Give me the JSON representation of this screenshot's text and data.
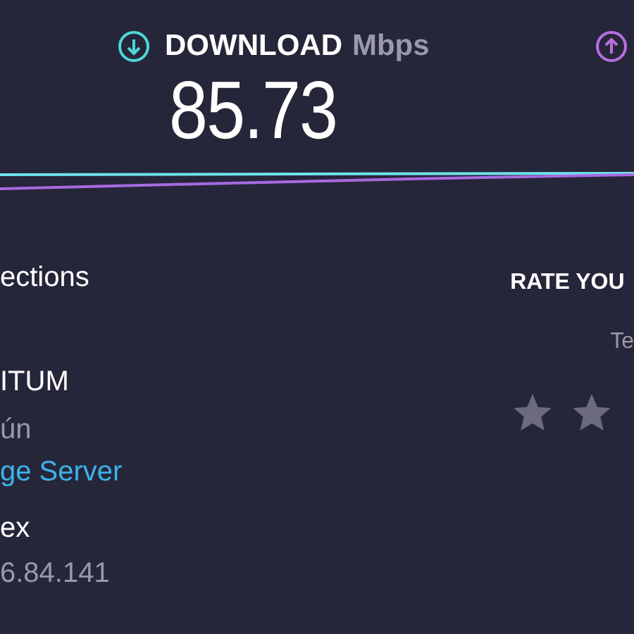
{
  "download": {
    "label": "DOWNLOAD",
    "unit": "Mbps",
    "value": "85.73"
  },
  "connections": {
    "label": "ections"
  },
  "server": {
    "provider": "ITUM",
    "location": "ún",
    "link": "ge Server",
    "host": "ex",
    "ip": "6.84.141"
  },
  "rating": {
    "title": "RATE YOU",
    "subtitle": "Te",
    "options": [
      {
        "selected": false
      },
      {
        "selected": false
      }
    ]
  }
}
